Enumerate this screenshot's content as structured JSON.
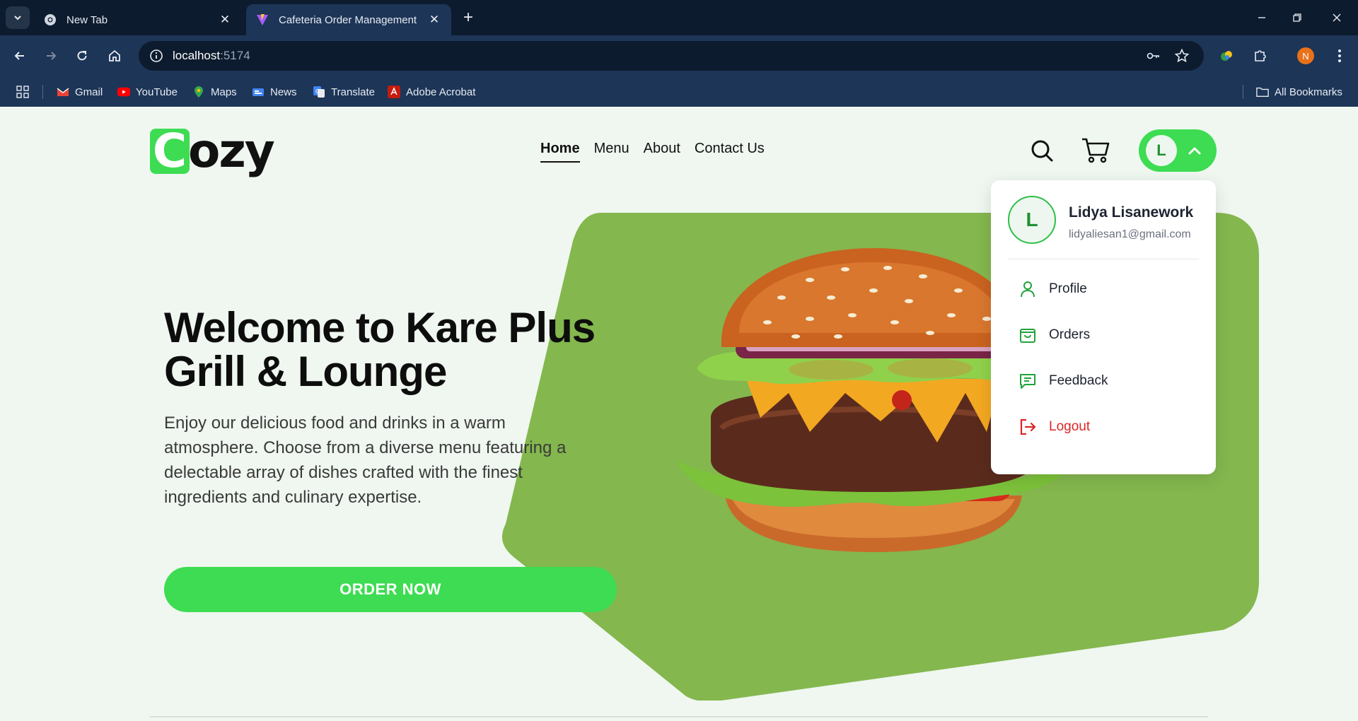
{
  "browser": {
    "tabs": [
      {
        "title": "New Tab",
        "active": false,
        "icon": "chrome-icon"
      },
      {
        "title": "Cafeteria Order Management",
        "active": true,
        "icon": "vite-icon"
      }
    ],
    "address": {
      "host": "localhost",
      "port": ":5174"
    },
    "profile_initial": "N",
    "bookmarks": [
      {
        "label": "Gmail",
        "icon": "gmail-icon"
      },
      {
        "label": "YouTube",
        "icon": "youtube-icon"
      },
      {
        "label": "Maps",
        "icon": "maps-icon"
      },
      {
        "label": "News",
        "icon": "news-icon"
      },
      {
        "label": "Translate",
        "icon": "translate-icon"
      },
      {
        "label": "Adobe Acrobat",
        "icon": "acrobat-icon"
      }
    ],
    "all_bookmarks": "All Bookmarks"
  },
  "site": {
    "logo": {
      "first_letter": "C",
      "rest": "ozy"
    },
    "nav": [
      {
        "label": "Home",
        "active": true
      },
      {
        "label": "Menu",
        "active": false
      },
      {
        "label": "About",
        "active": false
      },
      {
        "label": "Contact Us",
        "active": false
      }
    ],
    "user_initial": "L",
    "accent_color": "#3ddc52",
    "hero_bg_color": "#84b74e"
  },
  "hero": {
    "title": "Welcome to Kare Plus Grill & Lounge",
    "text": "Enjoy our delicious food and drinks in a warm atmosphere. Choose from a diverse menu featuring a delectable array of dishes crafted with the finest ingredients and culinary expertise.",
    "cta": "ORDER NOW"
  },
  "dropdown": {
    "initial": "L",
    "name": "Lidya Lisanework",
    "email": "lidyaliesan1@gmail.com",
    "items": [
      {
        "label": "Profile",
        "icon": "user-icon"
      },
      {
        "label": "Orders",
        "icon": "shopping-bag-icon"
      },
      {
        "label": "Feedback",
        "icon": "message-icon"
      },
      {
        "label": "Logout",
        "icon": "logout-icon"
      }
    ]
  }
}
